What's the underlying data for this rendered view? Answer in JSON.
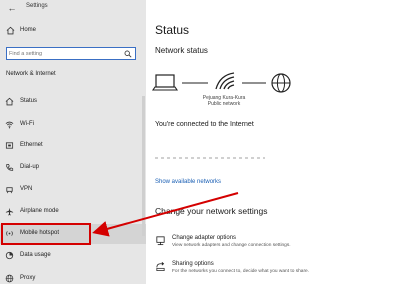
{
  "window": {
    "title": "Settings"
  },
  "sidebar": {
    "home_label": "Home",
    "search_placeholder": "Find a setting",
    "section_heading": "Network & Internet",
    "items": [
      {
        "label": "Status",
        "icon": "home-wired-icon"
      },
      {
        "label": "Wi-Fi",
        "icon": "wifi-icon"
      },
      {
        "label": "Ethernet",
        "icon": "ethernet-icon"
      },
      {
        "label": "Dial-up",
        "icon": "phone-icon"
      },
      {
        "label": "VPN",
        "icon": "vpn-icon"
      },
      {
        "label": "Airplane mode",
        "icon": "airplane-icon"
      },
      {
        "label": "Mobile hotspot",
        "icon": "hotspot-icon",
        "active": true
      },
      {
        "label": "Data usage",
        "icon": "data-usage-icon"
      },
      {
        "label": "Proxy",
        "icon": "globe-icon"
      }
    ]
  },
  "main": {
    "title": "Status",
    "network_status_heading": "Network status",
    "network_name": "Pejuang Kura-Kura",
    "network_type": "Public network",
    "connected_text": "You're connected to the Internet",
    "show_networks_link": "Show available networks",
    "change_heading": "Change your network settings",
    "options": [
      {
        "title": "Change adapter options",
        "desc": "View network adapters and change connection settings.",
        "icon": "adapter-icon"
      },
      {
        "title": "Sharing options",
        "desc": "For the networks you connect to, decide what you want to share.",
        "icon": "sharing-icon"
      }
    ]
  },
  "colors": {
    "accent": "#1a5fb4",
    "annotation": "#d40000",
    "sidebar_bg": "#e6e6e6"
  }
}
